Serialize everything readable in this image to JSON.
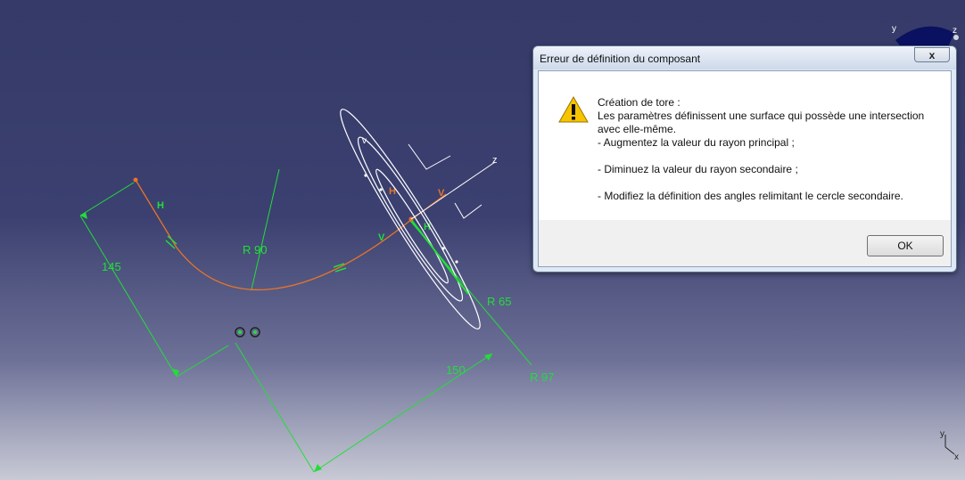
{
  "viewport": {
    "dimensions": {
      "len_145": "145",
      "r_90": "R 90",
      "r_65": "R 65",
      "r_97": "R 97",
      "len_150": "150"
    },
    "constraint_labels": {
      "h1": "H",
      "h2": "H",
      "v1": "V",
      "v2": "V",
      "h3": "H",
      "axis_z": "z",
      "axis_v": "v"
    },
    "compass": {
      "axis_y": "y",
      "axis_z": "z"
    },
    "triad": {
      "axis_y": "y",
      "axis_x": "x"
    },
    "colors": {
      "dimension": "#23dd3a",
      "curve": "#e8742a",
      "geometry": "#ffffff"
    }
  },
  "dialog": {
    "title": "Erreur de définition du composant",
    "close_label": "x",
    "icon": "warning-icon",
    "message": {
      "line1": "Création de tore :",
      "line2": "Les paramètres définissent une surface qui possède une intersection avec elle-même.",
      "line3": "- Augmentez la valeur du rayon principal ;",
      "line4": "- Diminuez la valeur du rayon secondaire ;",
      "line5": "- Modifiez la définition des angles relimitant le cercle secondaire."
    },
    "ok_label": "OK"
  }
}
